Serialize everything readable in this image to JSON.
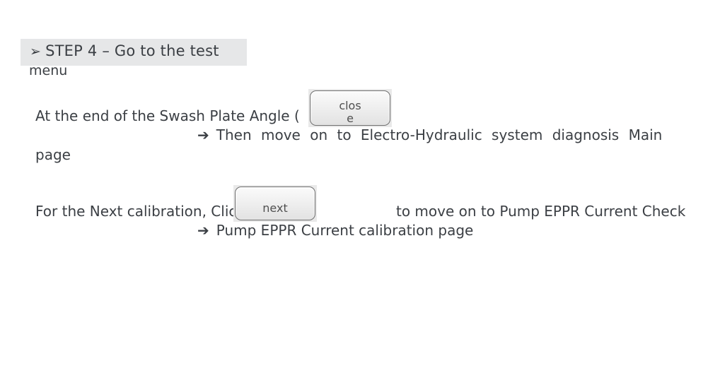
{
  "step": {
    "arrow_icon": "➢",
    "title": "STEP 4 – Go to the test",
    "title_cont": "menu"
  },
  "paragraph1": {
    "text_before": "At the end of the Swash Plate Angle (",
    "close_button_label": "close",
    "arrow_icon": "➔",
    "then_text": "Then move on to Electro-Hydraulic system diagnosis Main",
    "then_cont": "page"
  },
  "paragraph2": {
    "text_before": "For the Next calibration, Click",
    "next_button_label": "next",
    "text_after": "to move on to Pump EPPR Current Check",
    "arrow_icon": "➔",
    "then_text": "Pump EPPR Current calibration page"
  }
}
